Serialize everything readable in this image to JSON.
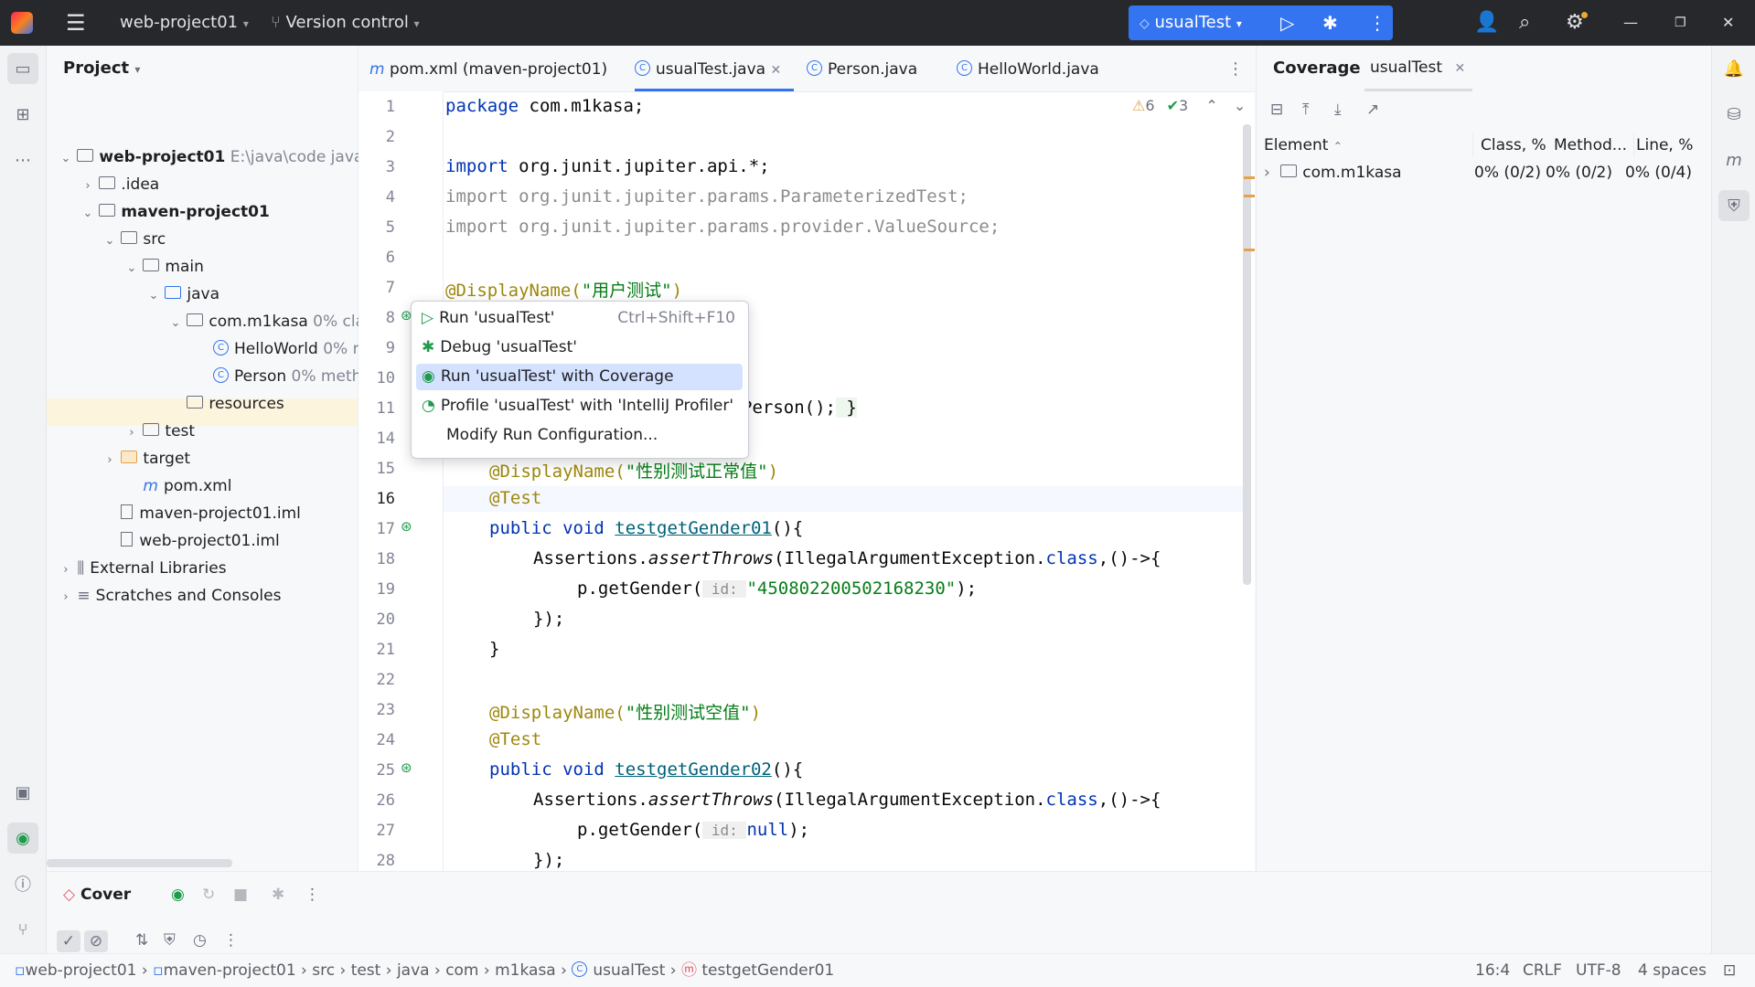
{
  "titlebar": {
    "project": "web-project01",
    "vcs": "Version control",
    "run_config": "usualTest"
  },
  "project_panel": {
    "title": "Project",
    "tree": [
      {
        "label": "web-project01",
        "extra": "E:\\java\\code java"
      },
      {
        "label": ".idea"
      },
      {
        "label": "maven-project01"
      },
      {
        "label": "src"
      },
      {
        "label": "main"
      },
      {
        "label": "java"
      },
      {
        "label": "com.m1kasa",
        "extra": "0% cla"
      },
      {
        "label": "HelloWorld",
        "extra": "0% r"
      },
      {
        "label": "Person",
        "extra": "0% meth"
      },
      {
        "label": "resources"
      },
      {
        "label": "test"
      },
      {
        "label": "target"
      },
      {
        "label": "pom.xml"
      },
      {
        "label": "maven-project01.iml"
      },
      {
        "label": "web-project01.iml"
      },
      {
        "label": "External Libraries"
      },
      {
        "label": "Scratches and Consoles"
      }
    ]
  },
  "tabs": [
    {
      "label": "pom.xml (maven-project01)"
    },
    {
      "label": "usualTest.java"
    },
    {
      "label": "Person.java"
    },
    {
      "label": "HelloWorld.java"
    }
  ],
  "inspections": {
    "warnings": "6",
    "ok": "3"
  },
  "editor": {
    "line_numbers": [
      "1",
      "2",
      "3",
      "4",
      "5",
      "6",
      "7",
      "8",
      "9",
      "10",
      "11",
      "14",
      "15",
      "16",
      "17",
      "18",
      "19",
      "20",
      "21",
      "22",
      "23",
      "24",
      "25",
      "26",
      "27",
      "28"
    ],
    "lines": {
      "l1a": "package ",
      "l1b": "com.m1kasa;",
      "l3a": "import ",
      "l3b": "org.junit.jupiter.api.*;",
      "l4": "import org.junit.jupiter.params.ParameterizedTest;",
      "l5": "import org.junit.jupiter.params.provider.ValueSource;",
      "l7a": "@DisplayName(",
      "l7b": "\"用户测试\"",
      "l7c": ")",
      "l11a": "Person",
      "l11b": "();",
      "l11c": " }",
      "l15a": "@DisplayName(",
      "l15b": "\"性别测试正常值\"",
      "l15c": ")",
      "l16": "@Test",
      "l17a": "public void ",
      "l17b": "testgetGender01",
      "l17c": "(){",
      "l18a": "Assertions.",
      "l18b": "assertThrows",
      "l18c": "(IllegalArgumentException.",
      "l18d": "class",
      "l18e": ",()->{",
      "l19a": "p.getGender(",
      "l19b": " id: ",
      "l19c": "\"450802200502168230\"",
      "l19d": ");",
      "l20": "});",
      "l21": "}",
      "l23a": "@DisplayName(",
      "l23b": "\"性别测试空值\"",
      "l23c": ")",
      "l24": "@Test",
      "l25a": "public void ",
      "l25b": "testgetGender02",
      "l25c": "(){",
      "l26a": "Assertions.",
      "l26b": "assertThrows",
      "l26c": "(IllegalArgumentException.",
      "l26d": "class",
      "l26e": ",()->{",
      "l27a": "p.getGender(",
      "l27b": " id: ",
      "l27c": "null",
      "l27d": ");",
      "l28": "});"
    }
  },
  "popup": {
    "items": [
      {
        "label": "Run 'usualTest'",
        "shortcut": "Ctrl+Shift+F10"
      },
      {
        "label": "Debug 'usualTest'",
        "shortcut": ""
      },
      {
        "label": "Run 'usualTest' with Coverage",
        "shortcut": ""
      },
      {
        "label": "Profile 'usualTest' with 'IntelliJ Profiler'",
        "shortcut": ""
      },
      {
        "label": "Modify Run Configuration...",
        "shortcut": ""
      }
    ]
  },
  "coverage": {
    "title": "Coverage",
    "tab": "usualTest",
    "columns": [
      "Element",
      "Class, %",
      "Method...",
      "Line, %"
    ],
    "rows": [
      {
        "element": "com.m1kasa",
        "class": "0% (0/2)",
        "method": "0% (0/2)",
        "line": "0% (0/4)"
      }
    ]
  },
  "bottom": {
    "title": "Cover"
  },
  "statusbar": {
    "breadcrumbs": [
      "web-project01",
      "maven-project01",
      "src",
      "test",
      "java",
      "com",
      "m1kasa",
      "usualTest",
      "testgetGender01"
    ],
    "position": "16:4",
    "line_sep": "CRLF",
    "encoding": "UTF-8",
    "indent": "4 spaces"
  },
  "colors": {
    "accent": "#3574f0",
    "titlebar": "#27282c",
    "selection": "#d4e2ff"
  }
}
